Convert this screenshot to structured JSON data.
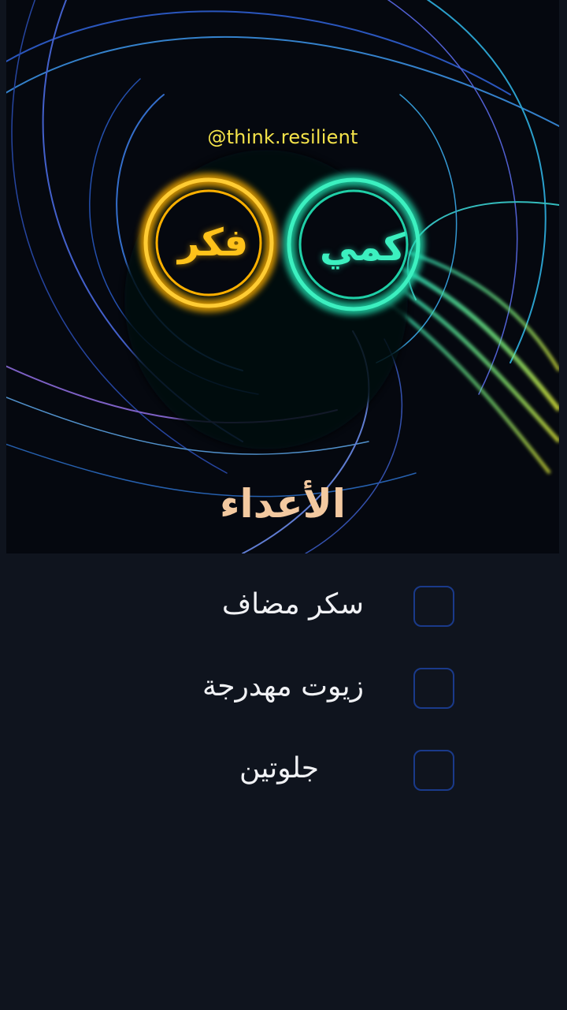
{
  "handle": "@think.resilient",
  "logo": {
    "left_ring_text": "فكر",
    "right_ring_text": "كمي",
    "left_color": "#ffc21a",
    "right_color": "#3cf0c0"
  },
  "title": "الأعداء",
  "checklist": [
    {
      "label": "سكر مضاف",
      "checked": false
    },
    {
      "label": "زيوت مهدرجة",
      "checked": false
    },
    {
      "label": "جلوتين",
      "checked": false
    }
  ],
  "colors": {
    "background": "#0f141e",
    "checkbox_border": "#1a3a8a",
    "handle": "#f4e34a",
    "title": "#f3c9a0"
  }
}
